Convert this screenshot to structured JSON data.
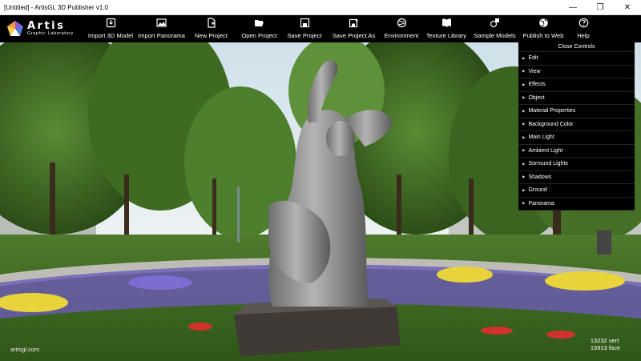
{
  "window": {
    "title": "[Untitled] - ArtisGL 3D Publisher v1.0",
    "controls": {
      "minimize": "—",
      "maximize": "❐",
      "close": "✕"
    }
  },
  "logo": {
    "name": "Artis",
    "tagline": "Graphic Laboratory"
  },
  "toolbar": {
    "items": [
      {
        "label": "Import 3D Model",
        "icon": "import-3d-icon"
      },
      {
        "label": "Import Panorama",
        "icon": "image-icon"
      },
      {
        "label": "New Project",
        "icon": "new-file-icon"
      },
      {
        "label": "Open Project",
        "icon": "folder-open-icon"
      },
      {
        "label": "Save Project",
        "icon": "save-icon"
      },
      {
        "label": "Save Project As",
        "icon": "save-as-icon"
      },
      {
        "label": "Environment",
        "icon": "environment-icon"
      },
      {
        "label": "Texture Library",
        "icon": "book-icon"
      },
      {
        "label": "Sample Models",
        "icon": "models-icon"
      },
      {
        "label": "Publish to Web",
        "icon": "globe-icon"
      },
      {
        "label": "Help",
        "icon": "help-icon"
      }
    ]
  },
  "panel": {
    "close_label": "Close Controls",
    "sections": [
      "Edit",
      "View",
      "Effects",
      "Object",
      "Material Properties",
      "Background Color",
      "Main Light",
      "Ambient Light",
      "Sorround Lights",
      "Shadows",
      "Ground",
      "Panorama"
    ]
  },
  "footer": {
    "site": "artisgl.com"
  },
  "stats": {
    "vertices": "13232 vert",
    "faces": "15913 face"
  },
  "colors": {
    "toolbar_bg": "#000000",
    "panel_bg": "#000000",
    "titlebar_bg": "#ffffff"
  }
}
